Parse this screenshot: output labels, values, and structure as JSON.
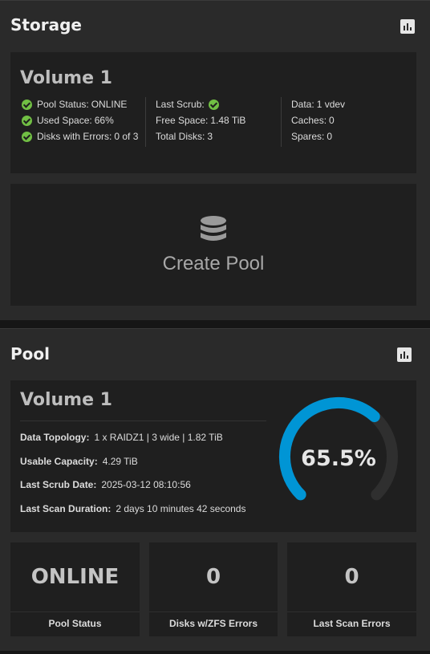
{
  "storage": {
    "title": "Storage",
    "volume": {
      "name": "Volume 1",
      "col1": [
        {
          "label": "Pool Status:",
          "value": "ONLINE"
        },
        {
          "label": "Used Space:",
          "value": "66%"
        },
        {
          "label": "Disks with Errors:",
          "value": "0 of 3"
        }
      ],
      "col2": [
        {
          "label": "Last Scrub:",
          "value": ""
        },
        {
          "label": "Free Space:",
          "value": "1.48 TiB"
        },
        {
          "label": "Total Disks:",
          "value": "3"
        }
      ],
      "col3": [
        {
          "label": "Data:",
          "value": "1 vdev"
        },
        {
          "label": "Caches:",
          "value": "0"
        },
        {
          "label": "Spares:",
          "value": "0"
        }
      ]
    },
    "create_pool_label": "Create Pool"
  },
  "pool": {
    "title": "Pool",
    "name": "Volume 1",
    "details": [
      {
        "label": "Data Topology:",
        "value": "1 x RAIDZ1 | 3 wide | 1.82 TiB"
      },
      {
        "label": "Usable Capacity:",
        "value": "4.29 TiB"
      },
      {
        "label": "Last Scrub Date:",
        "value": "2025-03-12 08:10:56"
      },
      {
        "label": "Last Scan Duration:",
        "value": "2 days 10 minutes 42 seconds"
      }
    ],
    "usage_percent": 65.5,
    "usage_label": "65.5%",
    "gauge_color": "#0095d5",
    "tiles": [
      {
        "value": "ONLINE",
        "label": "Pool Status"
      },
      {
        "value": "0",
        "label": "Disks w/ZFS Errors"
      },
      {
        "value": "0",
        "label": "Last Scan Errors"
      }
    ]
  },
  "colors": {
    "ok": "#71bf44",
    "accent": "#0095d5"
  },
  "icons": {
    "chart": "bar-chart-icon",
    "ok": "check-circle-icon",
    "database": "database-icon"
  }
}
